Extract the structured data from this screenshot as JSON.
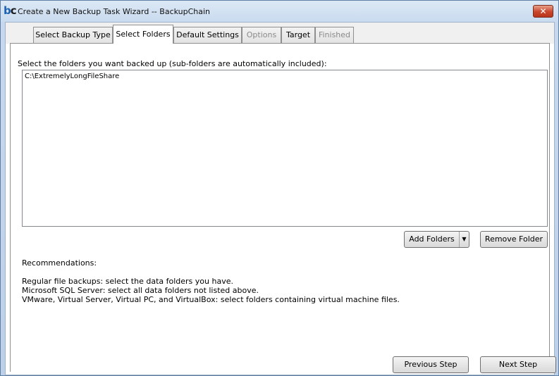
{
  "window": {
    "logo_b": "b",
    "logo_c": "c",
    "title": "Create a New Backup Task Wizard -- BackupChain",
    "close_label": "✕"
  },
  "tabs": [
    {
      "label": "Select Backup Type",
      "state": "enabled"
    },
    {
      "label": "Select Folders",
      "state": "active"
    },
    {
      "label": "Default Settings",
      "state": "enabled"
    },
    {
      "label": "Options",
      "state": "disabled"
    },
    {
      "label": "Target",
      "state": "enabled"
    },
    {
      "label": "Finished",
      "state": "disabled"
    }
  ],
  "folders": {
    "instruction": "Select the folders you want backed up (sub-folders are automatically included):",
    "items": [
      "C:\\ExtremelyLongFileShare"
    ],
    "add_label": "Add Folders",
    "add_arrow": "▼",
    "remove_label": "Remove Folder"
  },
  "recommendations": {
    "title": "Recommendations:",
    "lines": [
      "Regular file backups: select the data folders you have.",
      "Microsoft SQL Server: select all data folders not listed above.",
      "VMware, Virtual Server, Virtual PC, and VirtualBox: select folders containing virtual machine files."
    ]
  },
  "navigation": {
    "previous_label": "Previous Step",
    "next_label": "Next Step"
  }
}
